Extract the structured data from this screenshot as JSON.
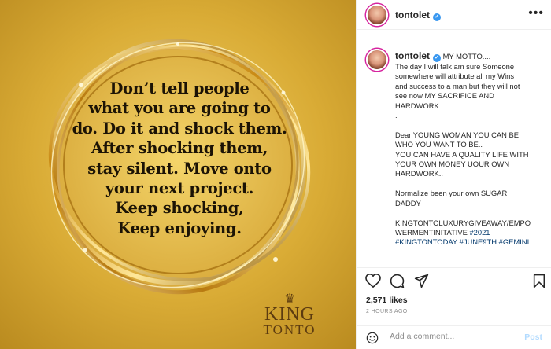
{
  "post": {
    "quote_lines": [
      "Don’t tell people",
      "what you are going to",
      "do. Do it and shock them.",
      "After shocking them,",
      "stay silent. Move onto",
      "your next project.",
      "Keep shocking,",
      "Keep enjoying."
    ],
    "brand_line1": "KING",
    "brand_line2": "TONTO",
    "colors": {
      "gold": "#d4a52c",
      "text": "#1c1305"
    }
  },
  "header": {
    "username": "tontolet",
    "verified_icon": "verified-badge-icon",
    "more_icon": "more-options-icon"
  },
  "caption": {
    "username": "tontolet",
    "lines": [
      "MY MOTTO....",
      "The day I will talk am sure Someone",
      "somewhere will attribute all my Wins",
      "and success to a man but they will not",
      "see now MY SACRIFICE AND",
      "HARDWORK..",
      ".",
      ".",
      "Dear YOUNG WOMAN YOU CAN BE",
      "WHO YOU WANT TO BE..",
      "YOU CAN HAVE A QUALITY LIFE WITH",
      "YOUR OWN MONEY UOUR OWN",
      "HARDWORK..",
      "",
      "Normalize been your own SUGAR",
      "DADDY",
      "",
      "KINGTONTOLUXURYGIVEAWAY/EMPO",
      "WERMENTINITATIVE"
    ],
    "hashtag_2021": "#2021",
    "hashtags_line": "#KINGTONTODAY #JUNE9TH #GEMINI"
  },
  "actions": {
    "icons": [
      "heart-icon",
      "comment-icon",
      "share-icon",
      "bookmark-icon"
    ]
  },
  "likes": "2,571 likes",
  "time": "2 HOURS AGO",
  "comment": {
    "placeholder": "Add a comment...",
    "post_label": "Post",
    "colors": {
      "link": "#00376b",
      "post_disabled": "#b3dbff",
      "verified": "#3897f0"
    }
  }
}
